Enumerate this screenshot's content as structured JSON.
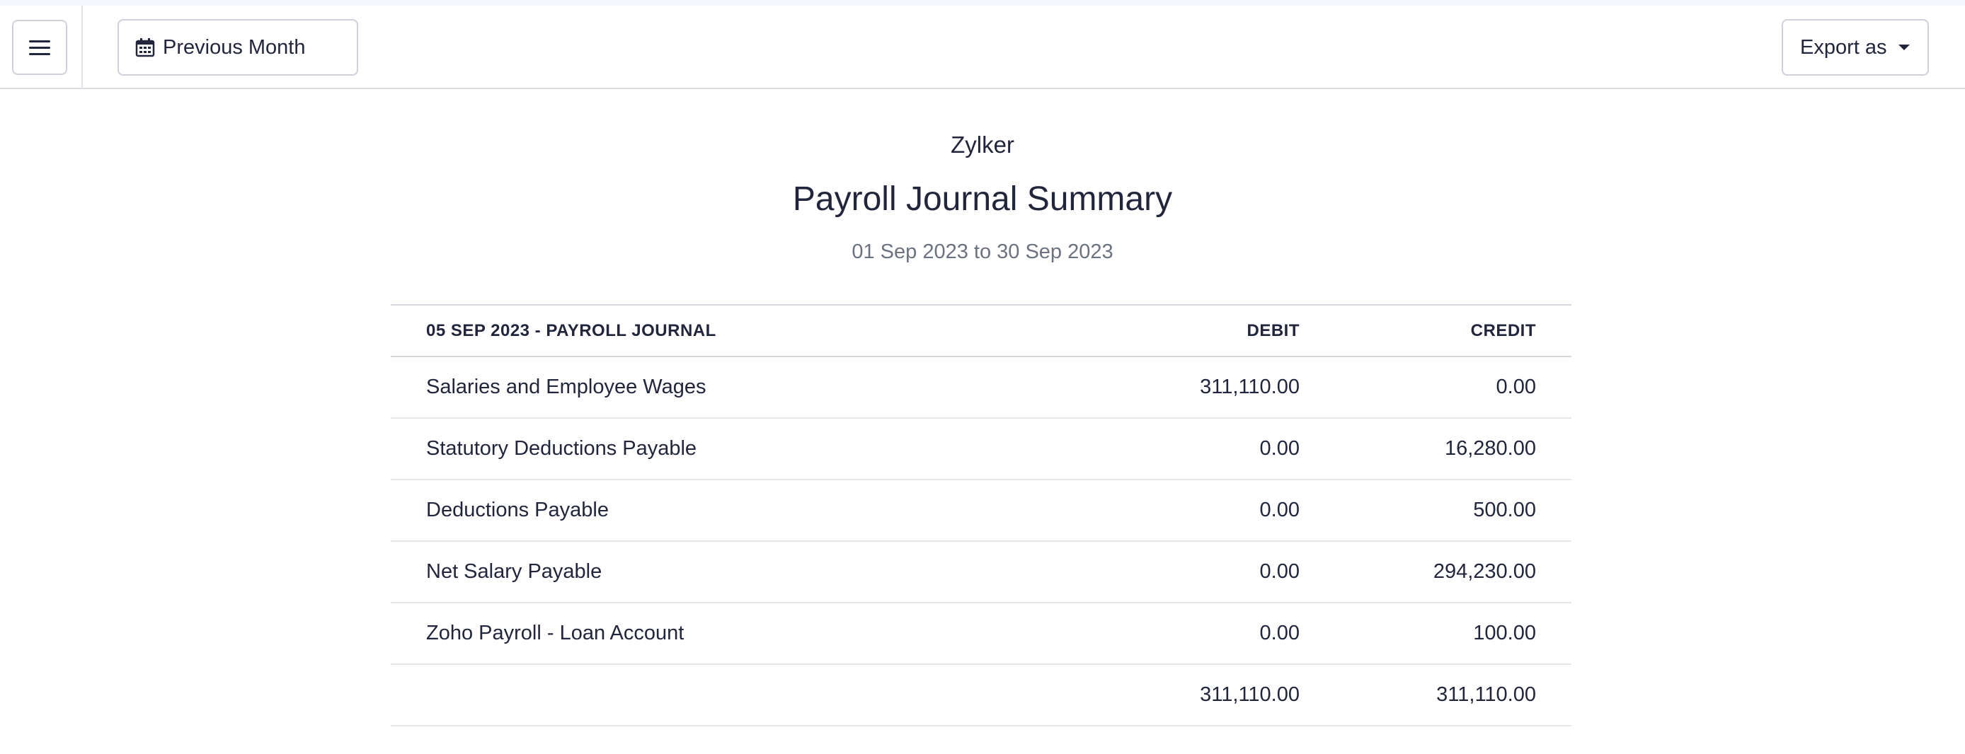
{
  "toolbar": {
    "period_label": "Previous Month",
    "export_label": "Export as"
  },
  "report": {
    "organization": "Zylker",
    "title": "Payroll Journal Summary",
    "date_range": "01 Sep 2023 to 30 Sep 2023",
    "columns": {
      "account": "05 SEP 2023 - PAYROLL JOURNAL",
      "debit": "DEBIT",
      "credit": "CREDIT"
    },
    "rows": [
      {
        "account": "Salaries and Employee Wages",
        "debit": "311,110.00",
        "credit": "0.00"
      },
      {
        "account": "Statutory Deductions Payable",
        "debit": "0.00",
        "credit": "16,280.00"
      },
      {
        "account": "Deductions Payable",
        "debit": "0.00",
        "credit": "500.00"
      },
      {
        "account": "Net Salary Payable",
        "debit": "0.00",
        "credit": "294,230.00"
      },
      {
        "account": "Zoho Payroll - Loan Account",
        "debit": "0.00",
        "credit": "100.00"
      }
    ],
    "totals": {
      "account": "",
      "debit": "311,110.00",
      "credit": "311,110.00"
    }
  }
}
